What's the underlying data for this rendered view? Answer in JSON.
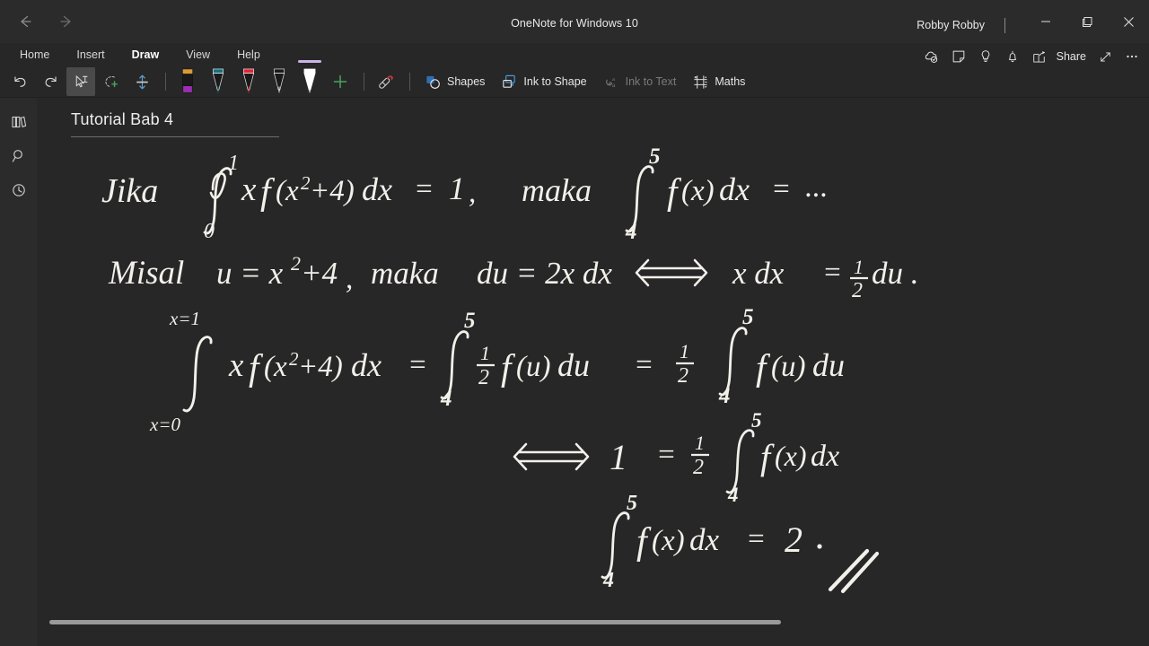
{
  "window": {
    "app_title": "OneNote for Windows 10",
    "user_name": "Robby Robby",
    "back_arrow": "←",
    "forward_arrow": "→",
    "minimize": "─",
    "maximize": "❐",
    "close": "✕",
    "back_icon_name": "back-arrow-icon",
    "forward_icon_name": "forward-arrow-icon"
  },
  "ribbon": {
    "tabs": [
      {
        "label": "Home",
        "active": false
      },
      {
        "label": "Insert",
        "active": false
      },
      {
        "label": "Draw",
        "active": true
      },
      {
        "label": "View",
        "active": false
      },
      {
        "label": "Help",
        "active": false
      }
    ],
    "right_actions": [
      {
        "label": "",
        "icon": "sync-cloud-icon"
      },
      {
        "label": "",
        "icon": "sticky-note-icon"
      },
      {
        "label": "",
        "icon": "lightbulb-icon"
      },
      {
        "label": "",
        "icon": "bell-icon"
      },
      {
        "label": "Share",
        "icon": "share-icon"
      },
      {
        "label": "",
        "icon": "expand-diagonal-icon"
      },
      {
        "label": "",
        "icon": "more-ellipsis-icon"
      }
    ]
  },
  "draw_toolbar": {
    "undo_label": "Undo",
    "redo_label": "Redo",
    "tools": [
      {
        "name": "select-type-tool",
        "label": "Type",
        "selected": true
      },
      {
        "name": "lasso-select-tool",
        "label": "Lasso Select",
        "selected": false
      },
      {
        "name": "insert-space-tool",
        "label": "Insert Space",
        "selected": false
      }
    ],
    "pens": [
      {
        "name": "highlighter-purple",
        "body": "#1a1a1a",
        "cap": "#d89b38",
        "tip": "#9b2fb0",
        "selected": false,
        "type": "highlighter"
      },
      {
        "name": "pen-teal",
        "body": "#1a1a1a",
        "cap": "#14707e",
        "tip": "#14707e",
        "selected": false,
        "type": "pen"
      },
      {
        "name": "pen-red",
        "body": "#1a1a1a",
        "cap": "#e62233",
        "tip": "#e62233",
        "selected": false,
        "type": "pen"
      },
      {
        "name": "pen-black",
        "body": "#1a1a1a",
        "cap": "#1a1a1a",
        "tip": "#d8d8d8",
        "selected": false,
        "type": "pen"
      },
      {
        "name": "pen-white",
        "body": "#ffffff",
        "cap": "#ffffff",
        "tip": "#ffffff",
        "selected": true,
        "type": "pen"
      }
    ],
    "selected_pen_indicator_color": "#c8b6e8",
    "add_pen_label": "+",
    "eraser_label": "Eraser",
    "commands": [
      {
        "label": "Shapes",
        "icon": "shapes-icon",
        "disabled": false
      },
      {
        "label": "Ink to Shape",
        "icon": "ink-to-shape-icon",
        "disabled": false
      },
      {
        "label": "Ink to Text",
        "icon": "ink-to-text-icon",
        "disabled": true
      },
      {
        "label": "Maths",
        "icon": "maths-icon",
        "disabled": false
      }
    ]
  },
  "left_rail": [
    {
      "name": "notebooks-icon",
      "label": "Notebooks"
    },
    {
      "name": "search-icon",
      "label": "Search"
    },
    {
      "name": "recent-clock-icon",
      "label": "Recent Edits"
    }
  ],
  "page": {
    "title": "Tutorial Bab 4",
    "ink_color": "#f2f0ea",
    "background_color": "#272727"
  },
  "ink_content": {
    "description": "Handwritten integral calculus substitution solution",
    "lines": [
      {
        "id": "line-1",
        "text": "Jika ∫₀¹ x f(x²+4) dx = 1,   maka  ∫₄⁵ f(x) dx = ..."
      },
      {
        "id": "line-2",
        "text": "Misal  u = x²+4 , maka  du = 2x dx  ⟺  x dx = ½ du ."
      },
      {
        "id": "line-3",
        "text": "∫(x=0)^(x=1) x f(x²+4) dx = ∫₄⁵ ½ f(u) du = ½ ∫₄⁵ f(u) du"
      },
      {
        "id": "line-4",
        "text": "⟺  1 = ½ ∫₄⁵ f(x) dx"
      },
      {
        "id": "line-5",
        "text": "∫₄⁵ f(x) dx = 2 ."
      }
    ],
    "tokens": {
      "jika": "Jika",
      "maka": "maka",
      "misal": "Misal",
      "u_eq": "u =",
      "x2p4": "x²+4",
      "comma": ",",
      "du_eq": "du =",
      "two_x_dx": "2x dx",
      "iff": "⟺",
      "x_dx": "x dx",
      "equals": "=",
      "half": "½",
      "du": "du .",
      "one": "1",
      "dots": "...",
      "answer": "2 .",
      "lower_0": "0",
      "upper_1": "1",
      "lower_4": "4",
      "upper_5": "5",
      "x_eq_0": "x=0",
      "x_eq_1": "x=1"
    }
  }
}
